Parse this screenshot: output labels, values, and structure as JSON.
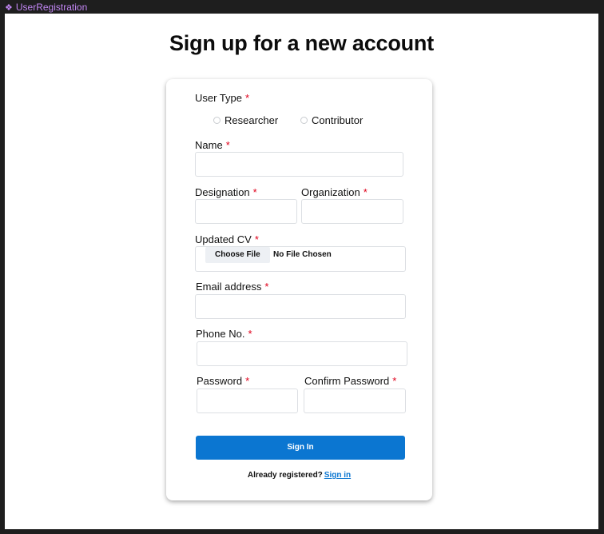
{
  "frame": {
    "label": "UserRegistration"
  },
  "page": {
    "title": "Sign up for a new account"
  },
  "form": {
    "user_type_label": "User Type",
    "user_type_options": [
      "Researcher",
      "Contributor"
    ],
    "name_label": "Name",
    "designation_label": "Designation",
    "organization_label": "Organization",
    "cv_label": "Updated CV",
    "file_button": "Choose File",
    "file_status": "No File Chosen",
    "email_label": "Email address",
    "phone_label": "Phone No.",
    "password_label": "Password",
    "confirm_password_label": "Confirm Password",
    "required_mark": "*",
    "submit_label": "Sign In",
    "footer_text": "Already registered?",
    "footer_link": "Sign in"
  },
  "colors": {
    "accent": "#0b76d1",
    "required": "#e0001b",
    "frame_label": "#c387f5"
  }
}
